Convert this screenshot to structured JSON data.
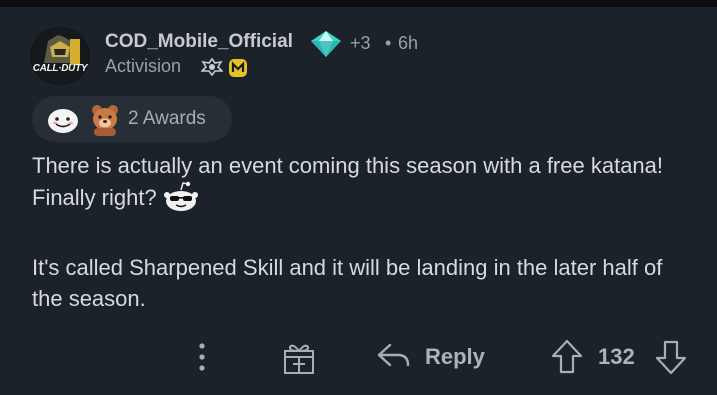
{
  "comment": {
    "author": "COD_Mobile_Official",
    "avatar_text": "CALL·DUTY",
    "award_extra": "+3",
    "separator": "•",
    "age": "6h",
    "flair": "Activision",
    "awards_label": "2 Awards",
    "body": {
      "line1": "There is actually an event coming this season with a free katana! Finally right?",
      "line2": "It's called Sharpened Skill and it will be landing in the later half of the season."
    }
  },
  "actions": {
    "reply_label": "Reply",
    "score": "132"
  },
  "icons": {
    "avatar": "call-of-duty-avatar",
    "diamond": "diamond-award-icon",
    "flair_badge_1": "emblem-icon",
    "flair_badge_2": "cod-mobile-icon",
    "award_1": "wholesome-award-icon",
    "award_2": "bear-award-icon",
    "inline_emoji": "snoo-sunglasses-emoji",
    "more": "more-vertical-icon",
    "gift": "gift-award-icon",
    "reply": "reply-arrow-icon",
    "upvote": "upvote-arrow-icon",
    "downvote": "downvote-arrow-icon"
  },
  "colors": {
    "background": "#1b2229",
    "text": "#d7dadc",
    "muted": "#9aa0a6",
    "pill": "#272e35",
    "diamond": "#3fd0c8"
  }
}
